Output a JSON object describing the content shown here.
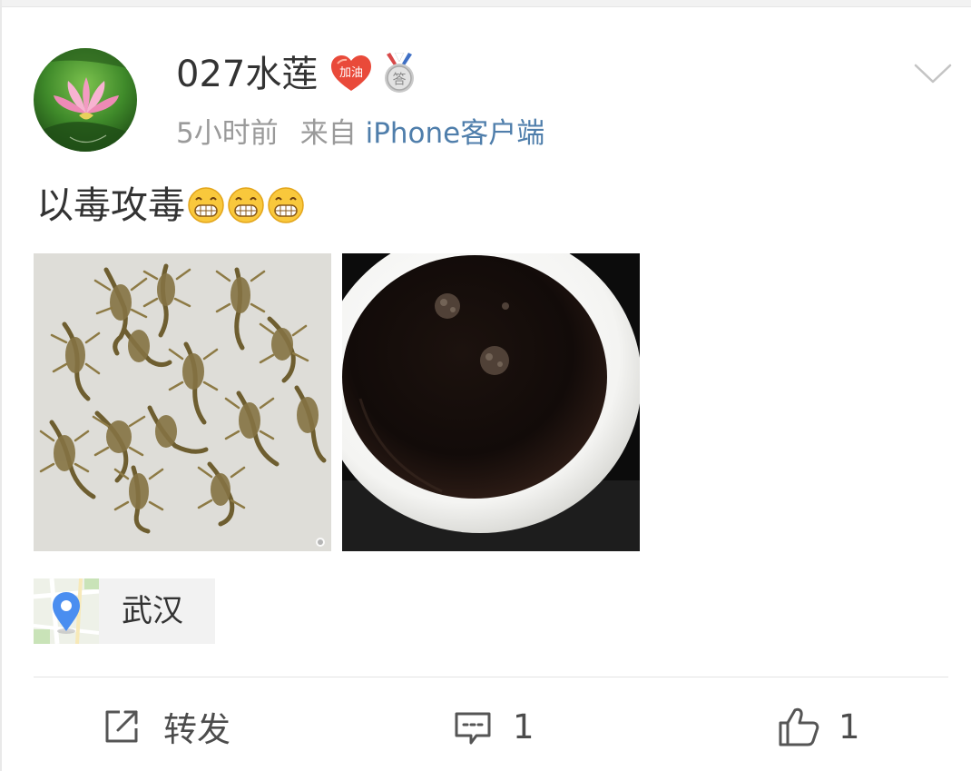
{
  "post": {
    "author": "027水莲",
    "badge_text": "加油",
    "medal_text": "答",
    "time": "5小时前",
    "source_prefix": "来自",
    "source": "iPhone客户端",
    "text": "以毒攻毒",
    "emojis": [
      "grin-emoji",
      "grin-emoji",
      "grin-emoji"
    ],
    "images": [
      "scorpions-photo",
      "dark-drink-bowl-photo"
    ],
    "location": "武汉"
  },
  "actions": {
    "repost_label": "转发",
    "comment_count": "1",
    "like_count": "1"
  },
  "icons": {
    "menu": "chevron-down-icon",
    "repost": "share-out-icon",
    "comment": "comment-icon",
    "like": "thumbs-up-icon",
    "location": "map-pin-icon"
  },
  "colors": {
    "source_link": "#4f7eab",
    "meta_gray": "#9a9a9a",
    "text": "#333333",
    "pin_blue": "#4a8ef0"
  }
}
